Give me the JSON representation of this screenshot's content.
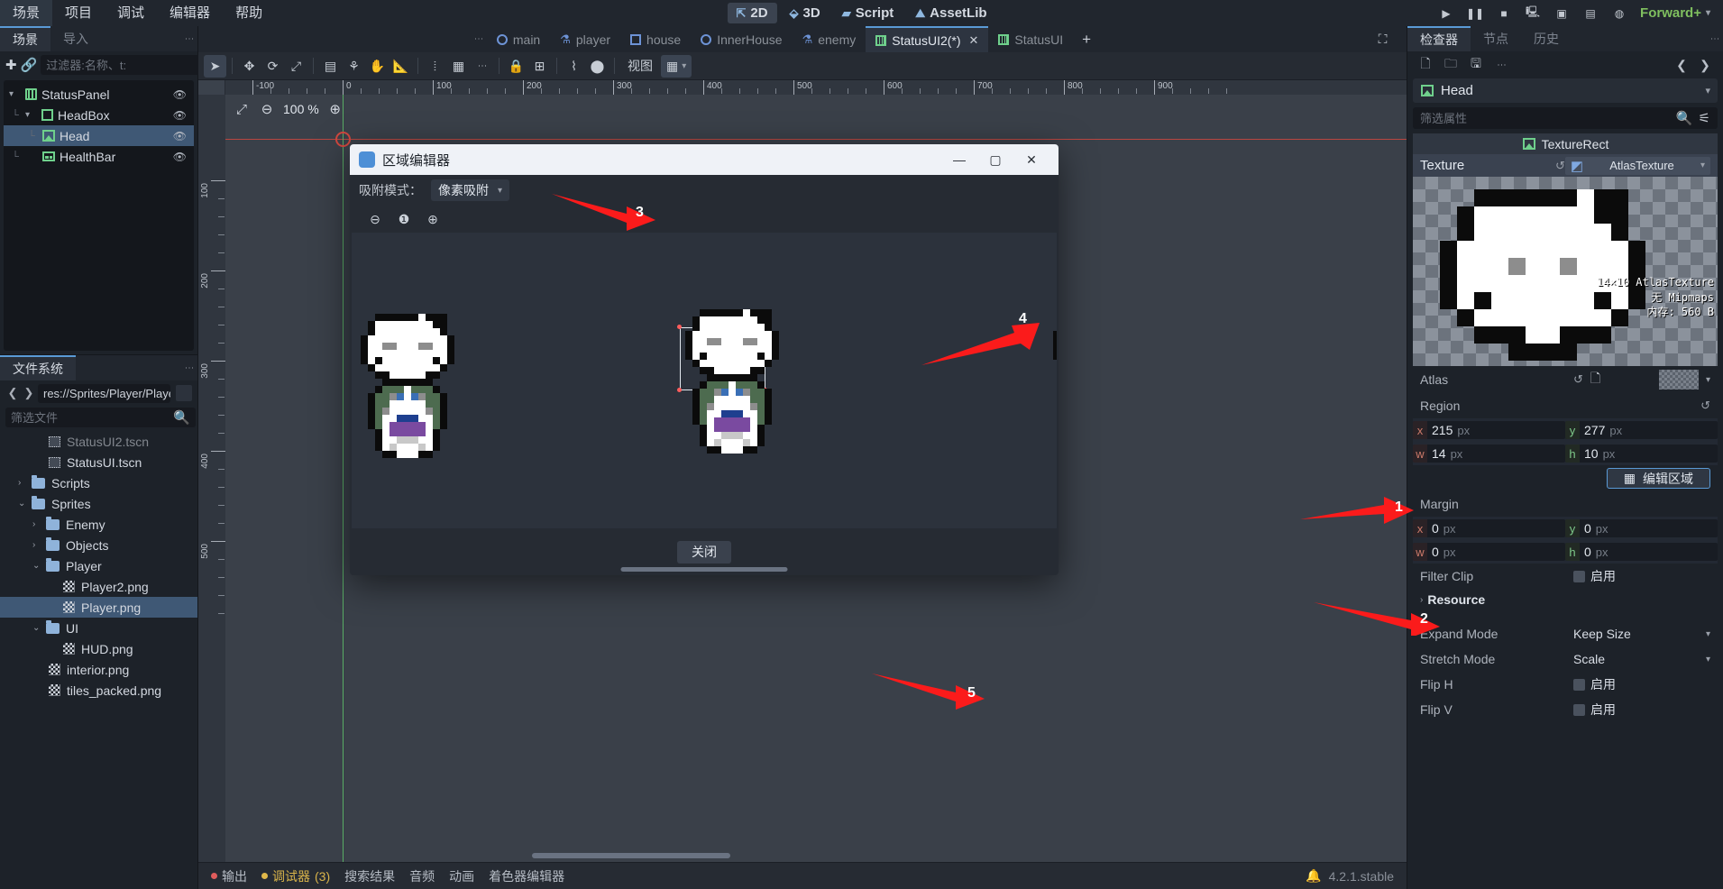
{
  "menubar": {
    "items": [
      "场景",
      "项目",
      "调试",
      "编辑器",
      "帮助"
    ],
    "center": [
      {
        "label": "2D",
        "icon": "2d-icon",
        "active": true
      },
      {
        "label": "3D",
        "icon": "3d-icon",
        "active": false
      },
      {
        "label": "Script",
        "icon": "script-icon",
        "active": false
      },
      {
        "label": "AssetLib",
        "icon": "assetlib-icon",
        "active": false
      }
    ],
    "play_buttons": [
      "play-icon",
      "pause-icon",
      "stop-icon",
      "play-scene-icon",
      "play-custom-icon",
      "movie-icon",
      "remote-debug-icon"
    ],
    "renderer": "Forward+"
  },
  "left_dock": {
    "tabs": [
      {
        "label": "场景",
        "active": true
      },
      {
        "label": "导入",
        "active": false
      }
    ],
    "toolbar": {
      "add_icon": "plus-icon",
      "link_icon": "link-icon",
      "filter_placeholder": "过滤器:名称、t:",
      "search_icon": "search-icon",
      "instance_icon": "instance-scene-icon",
      "more_icon": "more-vertical-icon"
    },
    "scene_tree": [
      {
        "label": "StatusPanel",
        "icon": "control-node-icon",
        "depth": 0,
        "expanded": true,
        "selected": false,
        "visible_icon": "eye-icon"
      },
      {
        "label": "HeadBox",
        "icon": "box-container-icon",
        "depth": 1,
        "expanded": true,
        "selected": false,
        "visible_icon": "eye-icon"
      },
      {
        "label": "Head",
        "icon": "texture-rect-icon",
        "depth": 2,
        "expanded": false,
        "selected": true,
        "visible_icon": "eye-icon"
      },
      {
        "label": "HealthBar",
        "icon": "progress-bar-icon",
        "depth": 1,
        "expanded": false,
        "selected": false,
        "visible_icon": "eye-icon"
      }
    ]
  },
  "filesystem": {
    "tab": "文件系统",
    "path": "res://Sprites/Player/Player.",
    "back_icon": "chevron-left-icon",
    "forward_icon": "chevron-right-icon",
    "filter_placeholder": "筛选文件",
    "search_icon": "search-icon",
    "sort_icon": "sort-icon",
    "tree": [
      {
        "label": "StatusUI2.tscn",
        "icon": "scene-file-icon",
        "depth": 2,
        "type": "file",
        "selected": false,
        "clipped": true
      },
      {
        "label": "StatusUI.tscn",
        "icon": "scene-file-icon",
        "depth": 2,
        "type": "file",
        "selected": false
      },
      {
        "label": "Scripts",
        "icon": "folder-icon",
        "depth": 1,
        "type": "folder",
        "expanded": false,
        "selected": false
      },
      {
        "label": "Sprites",
        "icon": "folder-icon",
        "depth": 1,
        "type": "folder",
        "expanded": true,
        "selected": false
      },
      {
        "label": "Enemy",
        "icon": "folder-icon",
        "depth": 2,
        "type": "folder",
        "expanded": false,
        "selected": false
      },
      {
        "label": "Objects",
        "icon": "folder-icon",
        "depth": 2,
        "type": "folder",
        "expanded": false,
        "selected": false
      },
      {
        "label": "Player",
        "icon": "folder-icon",
        "depth": 2,
        "type": "folder",
        "expanded": true,
        "selected": false
      },
      {
        "label": "Player2.png",
        "icon": "image-file-icon",
        "depth": 3,
        "type": "file",
        "selected": false
      },
      {
        "label": "Player.png",
        "icon": "image-file-icon",
        "depth": 3,
        "type": "file",
        "selected": true
      },
      {
        "label": "UI",
        "icon": "folder-icon",
        "depth": 2,
        "type": "folder",
        "expanded": true,
        "selected": false
      },
      {
        "label": "HUD.png",
        "icon": "image-file-icon",
        "depth": 3,
        "type": "file",
        "selected": false
      },
      {
        "label": "interior.png",
        "icon": "image-file-icon",
        "depth": 2,
        "type": "file",
        "selected": false
      },
      {
        "label": "tiles_packed.png",
        "icon": "image-file-icon",
        "depth": 2,
        "type": "file",
        "selected": false
      }
    ]
  },
  "scene_tabs": {
    "items": [
      {
        "label": "main",
        "icon": "node2d-circle-icon",
        "active": false,
        "closable": false
      },
      {
        "label": "player",
        "icon": "character-body-icon",
        "active": false,
        "closable": false
      },
      {
        "label": "house",
        "icon": "dashed-box-icon",
        "active": false,
        "closable": false
      },
      {
        "label": "InnerHouse",
        "icon": "node2d-circle-icon",
        "active": false,
        "closable": false
      },
      {
        "label": "enemy",
        "icon": "character-body-icon",
        "active": false,
        "closable": false
      },
      {
        "label": "StatusUI2(*)",
        "icon": "control-node-icon",
        "active": true,
        "closable": true
      },
      {
        "label": "StatusUI",
        "icon": "control-node-icon",
        "active": false,
        "closable": false
      }
    ],
    "add_label": "+",
    "expand_icon": "expand-icon",
    "more_icon": "more-vertical-icon"
  },
  "canvas_toolbar": {
    "tools": [
      {
        "icon": "select-tool-icon",
        "active": true
      },
      {
        "icon": "move-tool-icon",
        "active": false
      },
      {
        "icon": "rotate-tool-icon",
        "active": false
      },
      {
        "icon": "scale-tool-icon",
        "active": false
      },
      {
        "icon": "list-select-icon",
        "active": false
      },
      {
        "icon": "ruler-tool-icon",
        "active": false
      },
      {
        "icon": "pan-tool-icon",
        "active": false
      },
      {
        "icon": "ruler-measure-icon",
        "active": false
      },
      {
        "icon": "snap-rotation-icon",
        "active": false
      },
      {
        "icon": "grid-snap-icon",
        "active": false
      },
      {
        "icon": "snap-options-icon",
        "active": false
      },
      {
        "icon": "lock-icon",
        "active": false
      },
      {
        "icon": "group-icon",
        "active": false
      },
      {
        "icon": "skeleton-icon",
        "active": false
      },
      {
        "icon": "bone-icon",
        "active": false
      }
    ],
    "view_label": "视图",
    "grid_toggle_icon": "grid-icon"
  },
  "viewport": {
    "zoom": "100 %",
    "zoom_out_icon": "minus-icon",
    "zoom_in_icon": "plus-icon",
    "zoom_reset_icon": "zoom-fit-icon",
    "h_ruler_labels": [
      "-100",
      "0",
      "100",
      "200",
      "300",
      "400",
      "500",
      "600",
      "700",
      "800",
      "900"
    ],
    "v_ruler_labels": [
      "100",
      "200",
      "300",
      "400",
      "500"
    ]
  },
  "bottom_bar": {
    "items": [
      {
        "label": "输出",
        "dot": "red",
        "active": false
      },
      {
        "label": "调试器",
        "suffix": "(3)",
        "dot": "yellow",
        "active": true
      },
      {
        "label": "搜索结果",
        "active": false
      },
      {
        "label": "音频",
        "active": false
      },
      {
        "label": "动画",
        "active": false
      },
      {
        "label": "着色器编辑器",
        "active": false
      }
    ],
    "version": "4.2.1.stable",
    "bell_icon": "bell-icon"
  },
  "inspector": {
    "tabs": [
      {
        "label": "检查器",
        "active": true
      },
      {
        "label": "节点",
        "active": false
      },
      {
        "label": "历史",
        "active": false
      }
    ],
    "toolbar_icons": [
      "new-resource-icon",
      "open-resource-icon",
      "save-resource-icon",
      "more-vertical-icon"
    ],
    "nav_prev_icon": "chevron-left-icon",
    "nav_next_icon": "chevron-right-icon",
    "object_name": "Head",
    "object_icon": "texture-rect-icon",
    "filter_placeholder": "筛选属性",
    "search_icon": "search-icon",
    "filter_tool_icon": "filter-icon",
    "section_title": "TextureRect",
    "section_icon": "texture-rect-icon",
    "texture_row": {
      "label": "Texture",
      "revert_icon": "revert-icon",
      "type_icon": "atlas-texture-icon",
      "value": "AtlasTexture",
      "caret": "chevron-down-icon"
    },
    "preview_overlay": [
      "14×10 AtlasTexture",
      "无 Mipmaps",
      "内存: 560 B"
    ],
    "atlas_row": {
      "label": "Atlas",
      "revert_icon": "revert-icon",
      "quick_icon": "quick-load-icon",
      "caret": "chevron-down-icon"
    },
    "region": {
      "label": "Region",
      "revert_icon": "revert-icon",
      "x": "215",
      "y": "277",
      "w": "14",
      "h": "10",
      "unit": "px",
      "edit_button": "编辑区域",
      "edit_icon": "region-edit-icon"
    },
    "margin": {
      "label": "Margin",
      "x": "0",
      "y": "0",
      "w": "0",
      "h": "0",
      "unit": "px"
    },
    "filter_clip": {
      "label": "Filter Clip",
      "value": "启用",
      "checked": false
    },
    "resource_label": "Resource",
    "resource_caret": "chevron-right-icon",
    "props": [
      {
        "label": "Expand Mode",
        "value": "Keep Size",
        "type": "dropdown"
      },
      {
        "label": "Stretch Mode",
        "value": "Scale",
        "type": "dropdown"
      },
      {
        "label": "Flip H",
        "value": "启用",
        "type": "check",
        "checked": false
      },
      {
        "label": "Flip V",
        "value": "启用",
        "type": "check",
        "checked": false
      }
    ]
  },
  "dialog": {
    "title": "区域编辑器",
    "app_icon": "godot-icon",
    "minimize_icon": "minimize-icon",
    "maximize_icon": "maximize-icon",
    "close_icon": "close-icon",
    "snap_label": "吸附模式：",
    "snap_value": "像素吸附",
    "snap_caret": "chevron-down-icon",
    "zoom_out_icon": "minus-icon",
    "zoom_reset_icon": "zoom-one-icon",
    "zoom_in_icon": "plus-icon",
    "close_button": "关闭"
  },
  "annotations": [
    {
      "num": "1",
      "target": "region-label"
    },
    {
      "num": "2",
      "target": "edit-region-button"
    },
    {
      "num": "3",
      "target": "snap-mode-dropdown"
    },
    {
      "num": "4",
      "target": "selection-box"
    },
    {
      "num": "5",
      "target": "dialog-close-button"
    }
  ],
  "colors": {
    "accent": "#5a9ad6",
    "green": "#6fd08c",
    "annotation_red": "#fb1b1b",
    "selection_blue": "#3f5875",
    "renderer_green": "#7fbf5f"
  }
}
